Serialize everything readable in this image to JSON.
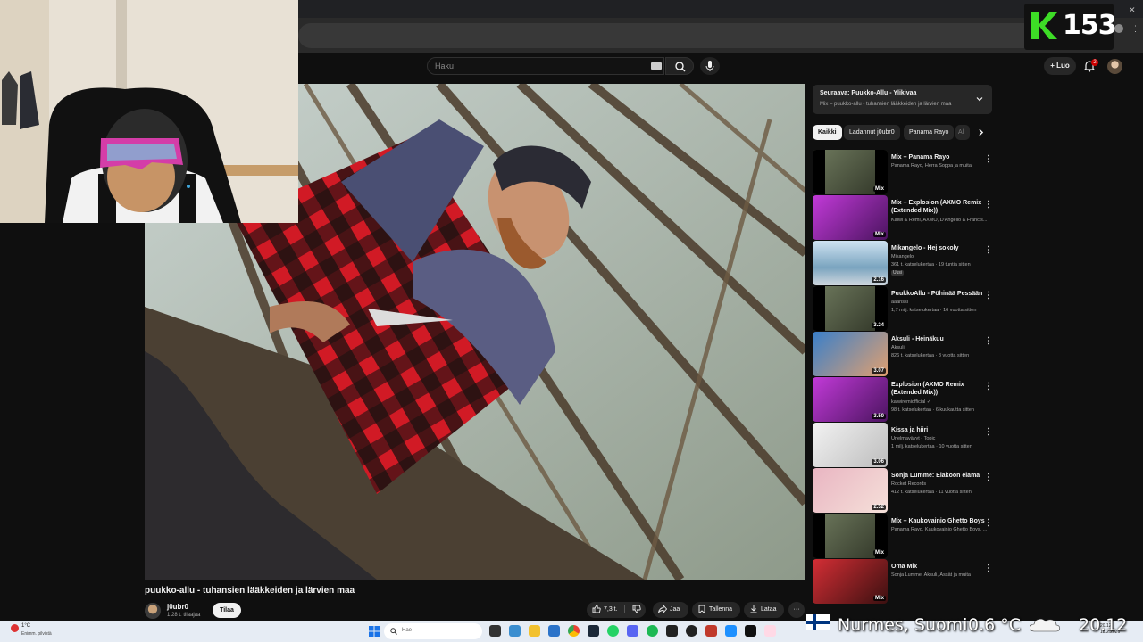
{
  "search": {
    "placeholder": "Haku"
  },
  "header": {
    "create_label": "Luo",
    "notification_count": "2"
  },
  "overlay": {
    "kill_count": "153",
    "location": "Nurmes, Suomi",
    "temperature": "0.6 °C",
    "time": "20.12"
  },
  "video": {
    "title": "puukko-allu - tuhansien lääkkeiden ja lärvien maa",
    "channel": "j0ubr0",
    "subscribers": "1,28 t. tilaajaa",
    "subscribe_label": "Tilaa",
    "likes": "7,3 t.",
    "share_label": "Jaa",
    "save_label": "Tallenna",
    "download_label": "Lataa"
  },
  "up_next": {
    "title": "Seuraava: Puukko-Allu - Ylikivaa",
    "subtitle": "Mix – puukko-allu - tuhansien lääkkeiden ja lärvien maa"
  },
  "chips": [
    "Kaikki",
    "Ladannut j0ubr0",
    "Panama Rayo",
    "Al"
  ],
  "recommendations": [
    {
      "title": "Mix – Panama Rayo",
      "meta1": "Panama Rayo, Herra Soppa ja muita",
      "meta2": "",
      "badge": "Mix",
      "thumb": "man"
    },
    {
      "title": "Mix – Explosion (AXMO Remix (Extended Mix))",
      "meta1": "Kalwi & Remi, AXMO, D'Angello & Francis...",
      "meta2": "",
      "badge": "Mix",
      "thumb": "purple"
    },
    {
      "title": "Mikangelo - Hej sokoly",
      "meta1": "Mikangelo",
      "meta2": "361 t. katselukertaa · 19 tuntia sitten",
      "tag": "Uusi",
      "badge": "2.16",
      "thumb": "sky"
    },
    {
      "title": "PuukkoAllu - Pöhinää Pessään",
      "meta1": "aaanssi",
      "meta2": "1,7 milj. katselukertaa · 16 vuotta sitten",
      "badge": "3.24",
      "thumb": "man"
    },
    {
      "title": "Aksuli - Heinäkuu",
      "meta1": "Aksuli",
      "meta2": "826 t. katselukertaa · 8 vuotta sitten",
      "badge": "3.07",
      "thumb": "blue"
    },
    {
      "title": "Explosion (AXMO Remix (Extended Mix))",
      "meta1": "kalwiremiofficial ✓",
      "meta2": "98 t. katselukertaa · 6 kuukautta sitten",
      "badge": "3.50",
      "thumb": "purple"
    },
    {
      "title": "Kissa ja hiiri",
      "meta1": "Unelmavävyt - Topic",
      "meta2": "1 milj. katselukertaa · 10 vuotta sitten",
      "badge": "3.06",
      "thumb": "white"
    },
    {
      "title": "Sonja Lumme: Eläköön elämä",
      "meta1": "Rocket Records",
      "meta2": "412 t. katselukertaa · 11 vuotta sitten",
      "badge": "2.52",
      "thumb": "pink"
    },
    {
      "title": "Mix – Kaukovainio Ghetto Boys",
      "meta1": "Panama Rayo, Kaukovainio Ghetto Boys, ...",
      "meta2": "",
      "badge": "Mix",
      "thumb": "man"
    },
    {
      "title": "Oma Mix",
      "meta1": "Sonja Lumme, Aksuli, Ässät ja muita",
      "meta2": "",
      "badge": "Mix",
      "thumb": "red"
    }
  ],
  "taskbar": {
    "weather_temp": "1°C",
    "weather_desc": "Enimm. pilvistä",
    "search_placeholder": "Hae",
    "clock_time": "20.12",
    "clock_date": "18.2.2026"
  },
  "colors": {
    "accent_green": "#3ddc26",
    "badge_red": "#cc0000",
    "taskbar_bg": "#e6ecf4"
  }
}
